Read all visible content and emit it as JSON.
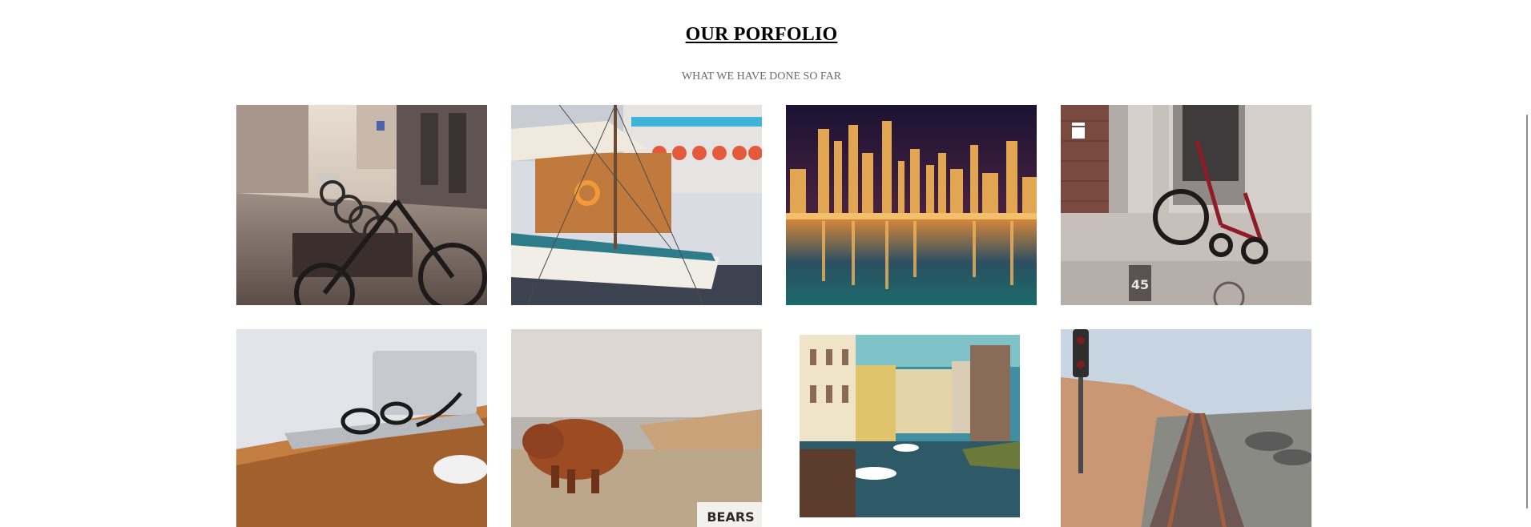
{
  "portfolio": {
    "title": "OUR PORFOLIO",
    "subtitle": "WHAT WE HAVE DONE SO FAR"
  },
  "tiles": [
    {
      "subject": "street-bicycles",
      "badge": ""
    },
    {
      "subject": "sailboat-harbor",
      "badge": ""
    },
    {
      "subject": "city-skyline-night",
      "badge": ""
    },
    {
      "subject": "red-tricycle",
      "badge": "45"
    },
    {
      "subject": "laptop-glasses-desk",
      "badge": ""
    },
    {
      "subject": "highland-cow",
      "badge": "BEARS"
    },
    {
      "subject": "canal-houses",
      "badge": ""
    },
    {
      "subject": "railway-tracks",
      "badge": ""
    }
  ]
}
